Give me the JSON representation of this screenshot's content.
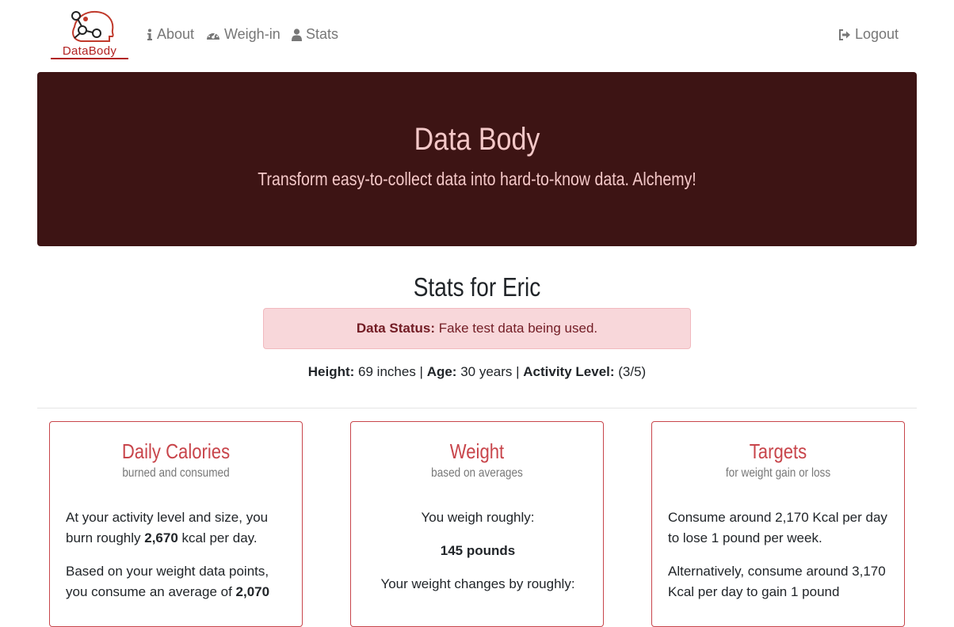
{
  "logo": {
    "text": "DataBody"
  },
  "nav": {
    "about": "About",
    "weigh_in": "Weigh-in",
    "stats": "Stats",
    "logout": "Logout"
  },
  "hero": {
    "title": "Data Body",
    "subtitle": "Transform easy-to-collect data into hard-to-know data. Alchemy!"
  },
  "stats_title": "Stats for Eric",
  "alert": {
    "label": "Data Status:",
    "text": " Fake test data being used."
  },
  "meta": {
    "height_label": "Height:",
    "height_value": " 69 inches | ",
    "age_label": "Age:",
    "age_value": " 30 years | ",
    "activity_label": "Activity Level:",
    "activity_value": " (3/5)"
  },
  "cards": {
    "calories": {
      "title": "Daily Calories",
      "subtitle": "burned and consumed",
      "p1_a": "At your activity level and size, you burn roughly ",
      "p1_b": "2,670",
      "p1_c": " kcal per day.",
      "p2_a": "Based on your weight data points, you consume an average of ",
      "p2_b": "2,070"
    },
    "weight": {
      "title": "Weight",
      "subtitle": "based on averages",
      "p1": "You weigh roughly:",
      "p2": "145 pounds",
      "p3": "Your weight changes by roughly:"
    },
    "targets": {
      "title": "Targets",
      "subtitle": "for weight gain or loss",
      "p1": "Consume around 2,170 Kcal per day to lose 1 pound per week.",
      "p2": "Alternatively, consume around 3,170 Kcal per day to gain 1 pound"
    }
  },
  "colors": {
    "hero_bg": "#3d1414",
    "hero_text": "#f4c8c8",
    "accent": "#c8454b",
    "alert_bg": "#f8d7da"
  },
  "icons": {
    "about": "info-icon",
    "weigh_in": "dashboard-icon",
    "stats": "user-icon",
    "logout": "logout-icon"
  }
}
